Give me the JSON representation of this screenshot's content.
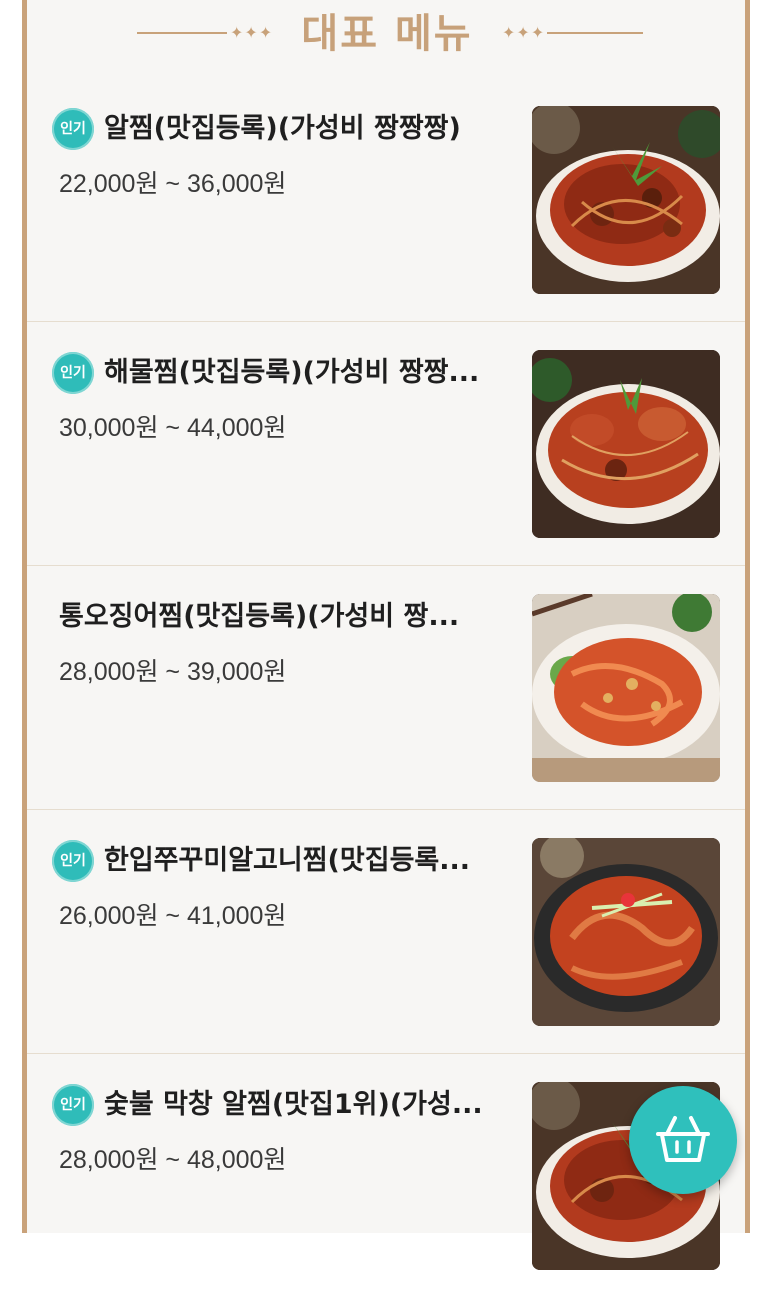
{
  "section": {
    "title": "대표 메뉴",
    "deco_left": "✦✦✦",
    "deco_right": "✦✦✦"
  },
  "menu_items": [
    {
      "badge": "인기",
      "name": "알찜(맛집등록)(가성비 짱짱짱)",
      "price": "22,000원 ~ 36,000원",
      "image_icon": "braised-seafood-photo"
    },
    {
      "badge": "인기",
      "name": "해물찜(맛집등록)(가성비 짱짱...",
      "price": "30,000원 ~ 44,000원",
      "image_icon": "braised-seafood-photo"
    },
    {
      "badge": "",
      "name": "통오징어찜(맛집등록)(가성비 짱...",
      "price": "28,000원 ~ 39,000원",
      "image_icon": "braised-squid-photo"
    },
    {
      "badge": "인기",
      "name": "한입쭈꾸미알고니찜(맛집등록...",
      "price": "26,000원 ~ 41,000원",
      "image_icon": "braised-octopus-photo"
    },
    {
      "badge": "인기",
      "name": "숯불 막창 알찜(맛집1위)(가성...",
      "price": "28,000원 ~ 48,000원",
      "image_icon": "braised-seafood-photo"
    }
  ],
  "cart_button": {
    "icon": "basket-icon"
  },
  "colors": {
    "accent_gold": "#c7a17a",
    "badge_teal": "#2fbcb9",
    "fab_teal": "#2fc0bc"
  }
}
